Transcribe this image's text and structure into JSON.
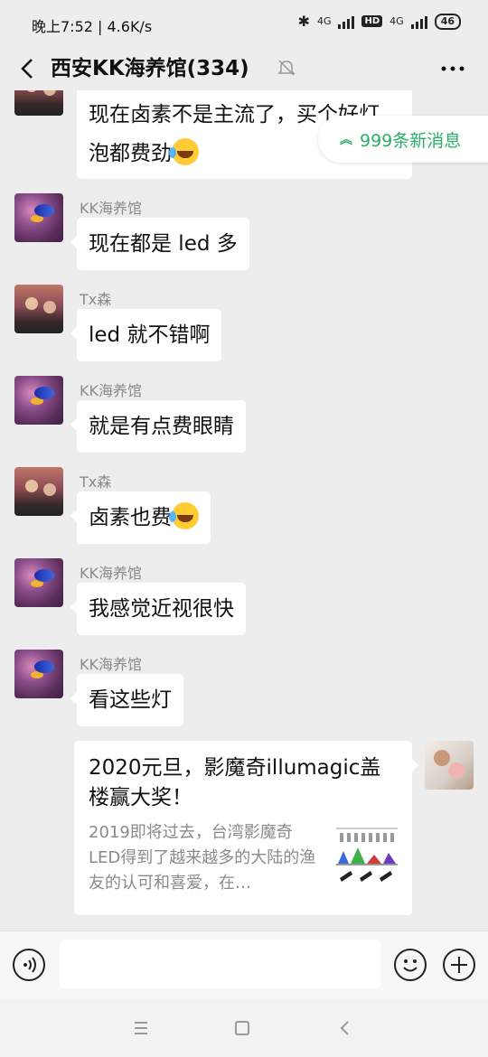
{
  "status_bar": {
    "time_speed": "晚上7:52 | 4.6K/s",
    "net1": "4G",
    "hd": "HD",
    "net2": "4G",
    "battery": "46",
    "icons": [
      "bluetooth-icon",
      "signal-icon",
      "signal-icon",
      "battery-icon"
    ]
  },
  "header": {
    "title": "西安KK海养馆(334)",
    "back_icon": "chevron-left-icon",
    "mute_icon": "bell-muted-icon",
    "more_icon": "more-dots-icon"
  },
  "new_messages": {
    "label": "999条新消息",
    "icon": "double-chevron-up-icon"
  },
  "messages": [
    {
      "sender": "",
      "text_line1": "现在卤素不是主流了，买个好灯",
      "text_line2": "泡都费劲",
      "emoji": "rolling-laugh-emoji"
    },
    {
      "sender": "KK海养馆",
      "text": "现在都是 led 多"
    },
    {
      "sender": "Tx森",
      "text": "led 就不错啊"
    },
    {
      "sender": "KK海养馆",
      "text": "就是有点费眼睛"
    },
    {
      "sender": "Tx森",
      "text": "卤素也费",
      "emoji": "rolling-laugh-emoji"
    },
    {
      "sender": "KK海养馆",
      "text": "我感觉近视很快"
    },
    {
      "sender": "KK海养馆",
      "text": "看这些灯"
    }
  ],
  "link_card": {
    "title": "2020元旦，影魔奇illumagic盖楼赢大奖！",
    "description": "2019即将过去，台湾影魔奇LED得到了越来越多的大陆的渔友的认可和喜爱，在…"
  },
  "input_bar": {
    "voice_icon": "voice-icon",
    "emoji_icon": "smiley-icon",
    "plus_icon": "plus-icon",
    "input_value": ""
  },
  "nav_bar": {
    "icons": [
      "menu-icon",
      "home-icon",
      "back-icon"
    ]
  }
}
